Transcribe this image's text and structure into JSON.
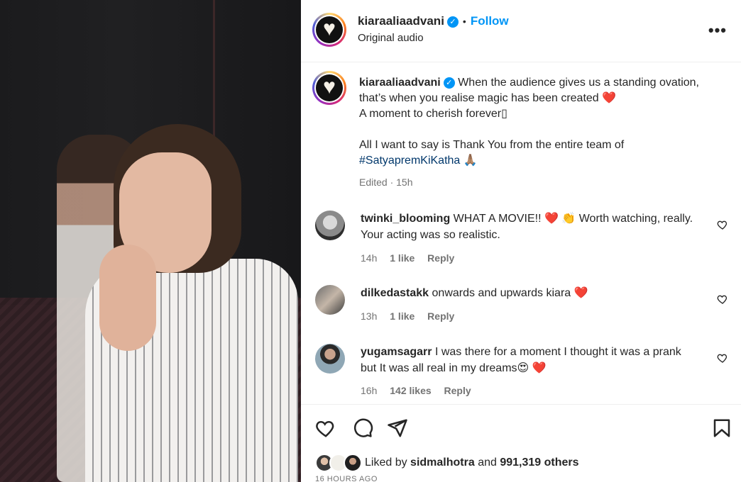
{
  "post": {
    "username": "kiaraaliaadvani",
    "follow_label": "Follow",
    "separator": "•",
    "audio": "Original audio",
    "more_label": "•••"
  },
  "caption": {
    "username": "kiaraaliaadvani",
    "line1": "When the audience gives us a standing ovation, that’s when you realise magic has been created",
    "line1_emoji": "❤️",
    "line2": "A moment to cherish forever▯",
    "line3": "All I want to say is Thank You from the entire team of",
    "hashtag": "#SatyapremKiKatha",
    "hashtag_emoji": "🙏🏽",
    "meta": "Edited · 15h"
  },
  "comments": [
    {
      "username": "twinki_blooming",
      "text": "WHAT A MOVIE!! ❤️ 👏 Worth watching, really. Your acting was so realistic.",
      "time": "14h",
      "likes": "1 like",
      "reply": "Reply"
    },
    {
      "username": "dilkedastakk",
      "text": "onwards and upwards kiara ❤️",
      "time": "13h",
      "likes": "1 like",
      "reply": "Reply"
    },
    {
      "username": "yugamsagarr",
      "text": "I was there for a moment I thought it was a prank but It was all real in my dreams😍 ❤️",
      "time": "16h",
      "likes": "142 likes",
      "reply": "Reply"
    }
  ],
  "liked_by": {
    "prefix": "Liked by",
    "user": "sidmalhotra",
    "and": "and",
    "count": "991,319 others"
  },
  "timestamp": "16 HOURS AGO",
  "colors": {
    "accent": "#0095f6",
    "heart": "#e0142b",
    "muted": "#737373",
    "hashtag": "#00376b"
  },
  "icons": [
    "verified-icon",
    "more-options-icon",
    "heart-icon",
    "comment-icon",
    "share-icon",
    "bookmark-icon",
    "small-heart-icon"
  ]
}
